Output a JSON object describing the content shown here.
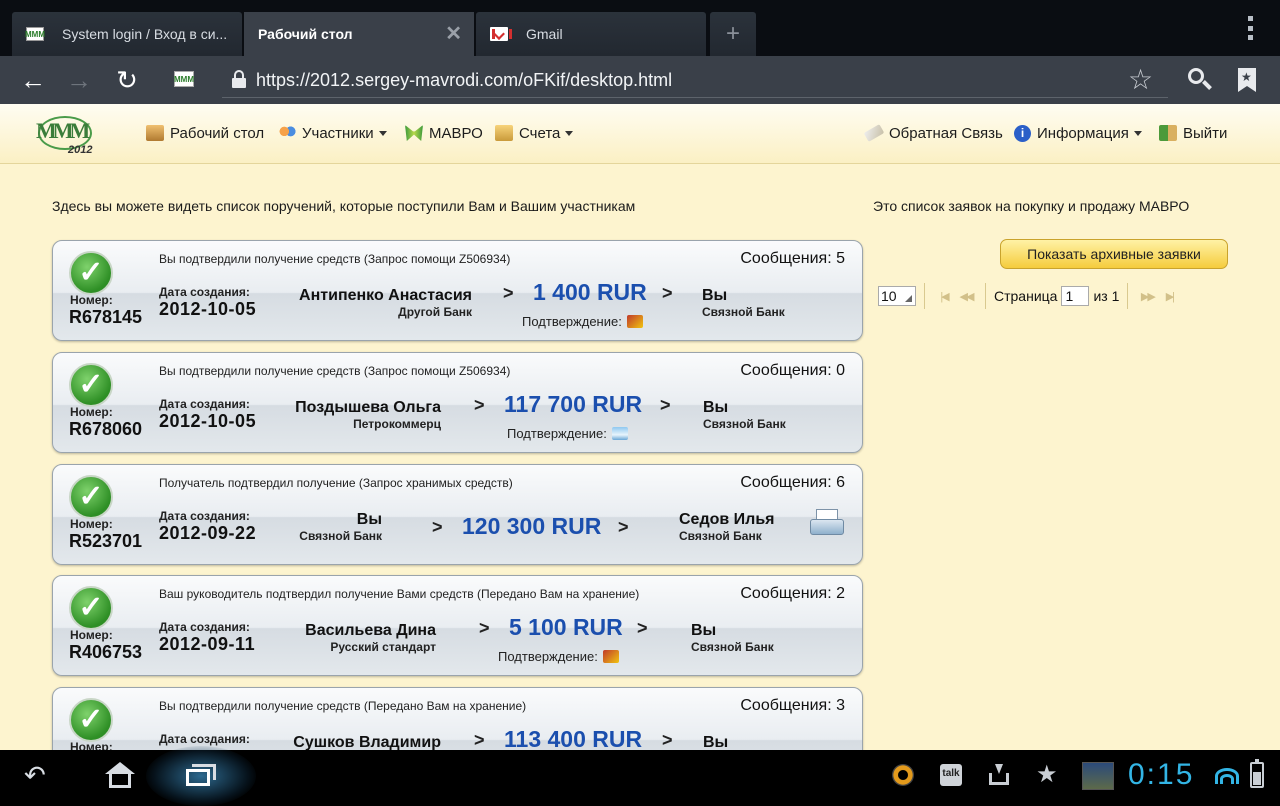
{
  "browser": {
    "tabs": [
      {
        "title": "System login / Вход в си...",
        "active": false
      },
      {
        "title": "Рабочий стол",
        "active": true
      },
      {
        "title": "Gmail",
        "active": false
      }
    ],
    "new_tab_symbol": "+",
    "url": "https://2012.sergey-mavrodi.com/oFKif/desktop.html",
    "icons": [
      "back-arrow-icon",
      "forward-arrow-icon",
      "reload-icon",
      "lock-icon",
      "star-icon",
      "search-icon",
      "bookmarks-icon",
      "overflow-menu-icon"
    ]
  },
  "site": {
    "logo_year": "2012",
    "logo_text": "MMM",
    "menu_left": [
      {
        "label": "Рабочий стол",
        "icon": "desktop-icon",
        "dropdown": false
      },
      {
        "label": "Участники",
        "icon": "users-icon",
        "dropdown": true
      },
      {
        "label": "МАВРО",
        "icon": "butterfly-icon",
        "dropdown": false
      },
      {
        "label": "Счета",
        "icon": "accounts-icon",
        "dropdown": true
      }
    ],
    "menu_right": [
      {
        "label": "Обратная Связь",
        "icon": "feedback-icon",
        "dropdown": false
      },
      {
        "label": "Информация",
        "icon": "info-icon",
        "dropdown": true
      },
      {
        "label": "Выйти",
        "icon": "exit-icon",
        "dropdown": false
      }
    ]
  },
  "main": {
    "intro_left": "Здесь вы можете видеть список поручений, которые поступили Вам и Вашим участникам",
    "intro_right": "Это список заявок на покупку и продажу МАВРО",
    "labels": {
      "number": "Номер:",
      "created": "Дата создания:",
      "messages_prefix": "Сообщения:",
      "confirmation": "Подтверждение:",
      "arrow": ">"
    },
    "orders": [
      {
        "status": "Вы подтвердили получение средств (Запрос помощи Z506934)",
        "messages": "Сообщения: 5",
        "number": "R678145",
        "date": "2012-10-05",
        "from_name": "Антипенко Анастасия",
        "from_bank": "Другой Банк",
        "amount": "1 400 RUR",
        "to_name": "Вы",
        "to_bank": "Связной Банк",
        "confirmation_icon": "photo-attachment-icon"
      },
      {
        "status": "Вы подтвердили получение средств (Запрос помощи Z506934)",
        "messages": "Сообщения: 0",
        "number": "R678060",
        "date": "2012-10-05",
        "from_name": "Поздышева Ольга",
        "from_bank": "Петрокоммерц",
        "amount": "117 700 RUR",
        "to_name": "Вы",
        "to_bank": "Связной Банк",
        "confirmation_icon": "image-attachment-icon"
      },
      {
        "status": "Получатель подтвердил получение (Запрос хранимых средств)",
        "messages": "Сообщения: 6",
        "number": "R523701",
        "date": "2012-09-22",
        "from_name": "Вы",
        "from_bank": "Связной Банк",
        "amount": "120 300 RUR",
        "to_name": "Седов Илья",
        "to_bank": "Связной Банк",
        "confirmation_icon": "printer-icon"
      },
      {
        "status": "Ваш руководитель подтвердил получение Вами средств (Передано Вам на хранение)",
        "messages": "Сообщения: 2",
        "number": "R406753",
        "date": "2012-09-11",
        "from_name": "Васильева Дина",
        "from_bank": "Русский стандарт",
        "amount": "5 100 RUR",
        "to_name": "Вы",
        "to_bank": "Связной Банк",
        "confirmation_icon": "photo-attachment-icon"
      },
      {
        "status": "Вы подтвердили получение средств (Передано Вам на хранение)",
        "messages": "Сообщения: 3",
        "number": "",
        "date": "",
        "from_name": "Сушков Владимир",
        "from_bank": "",
        "amount": "113 400 RUR",
        "to_name": "Вы",
        "to_bank": "",
        "confirmation_icon": ""
      }
    ],
    "archive_button": "Показать архивные заявки",
    "pager": {
      "page_size": "10",
      "page_label": "Страница",
      "page_value": "1",
      "of_label": "из 1",
      "first": "|◀",
      "prev": "◀◀",
      "next": "▶▶",
      "last": "▶|"
    }
  },
  "system_bar": {
    "clock": "0:15",
    "talk_label": "talk",
    "accent_color": "#33b5e5"
  }
}
